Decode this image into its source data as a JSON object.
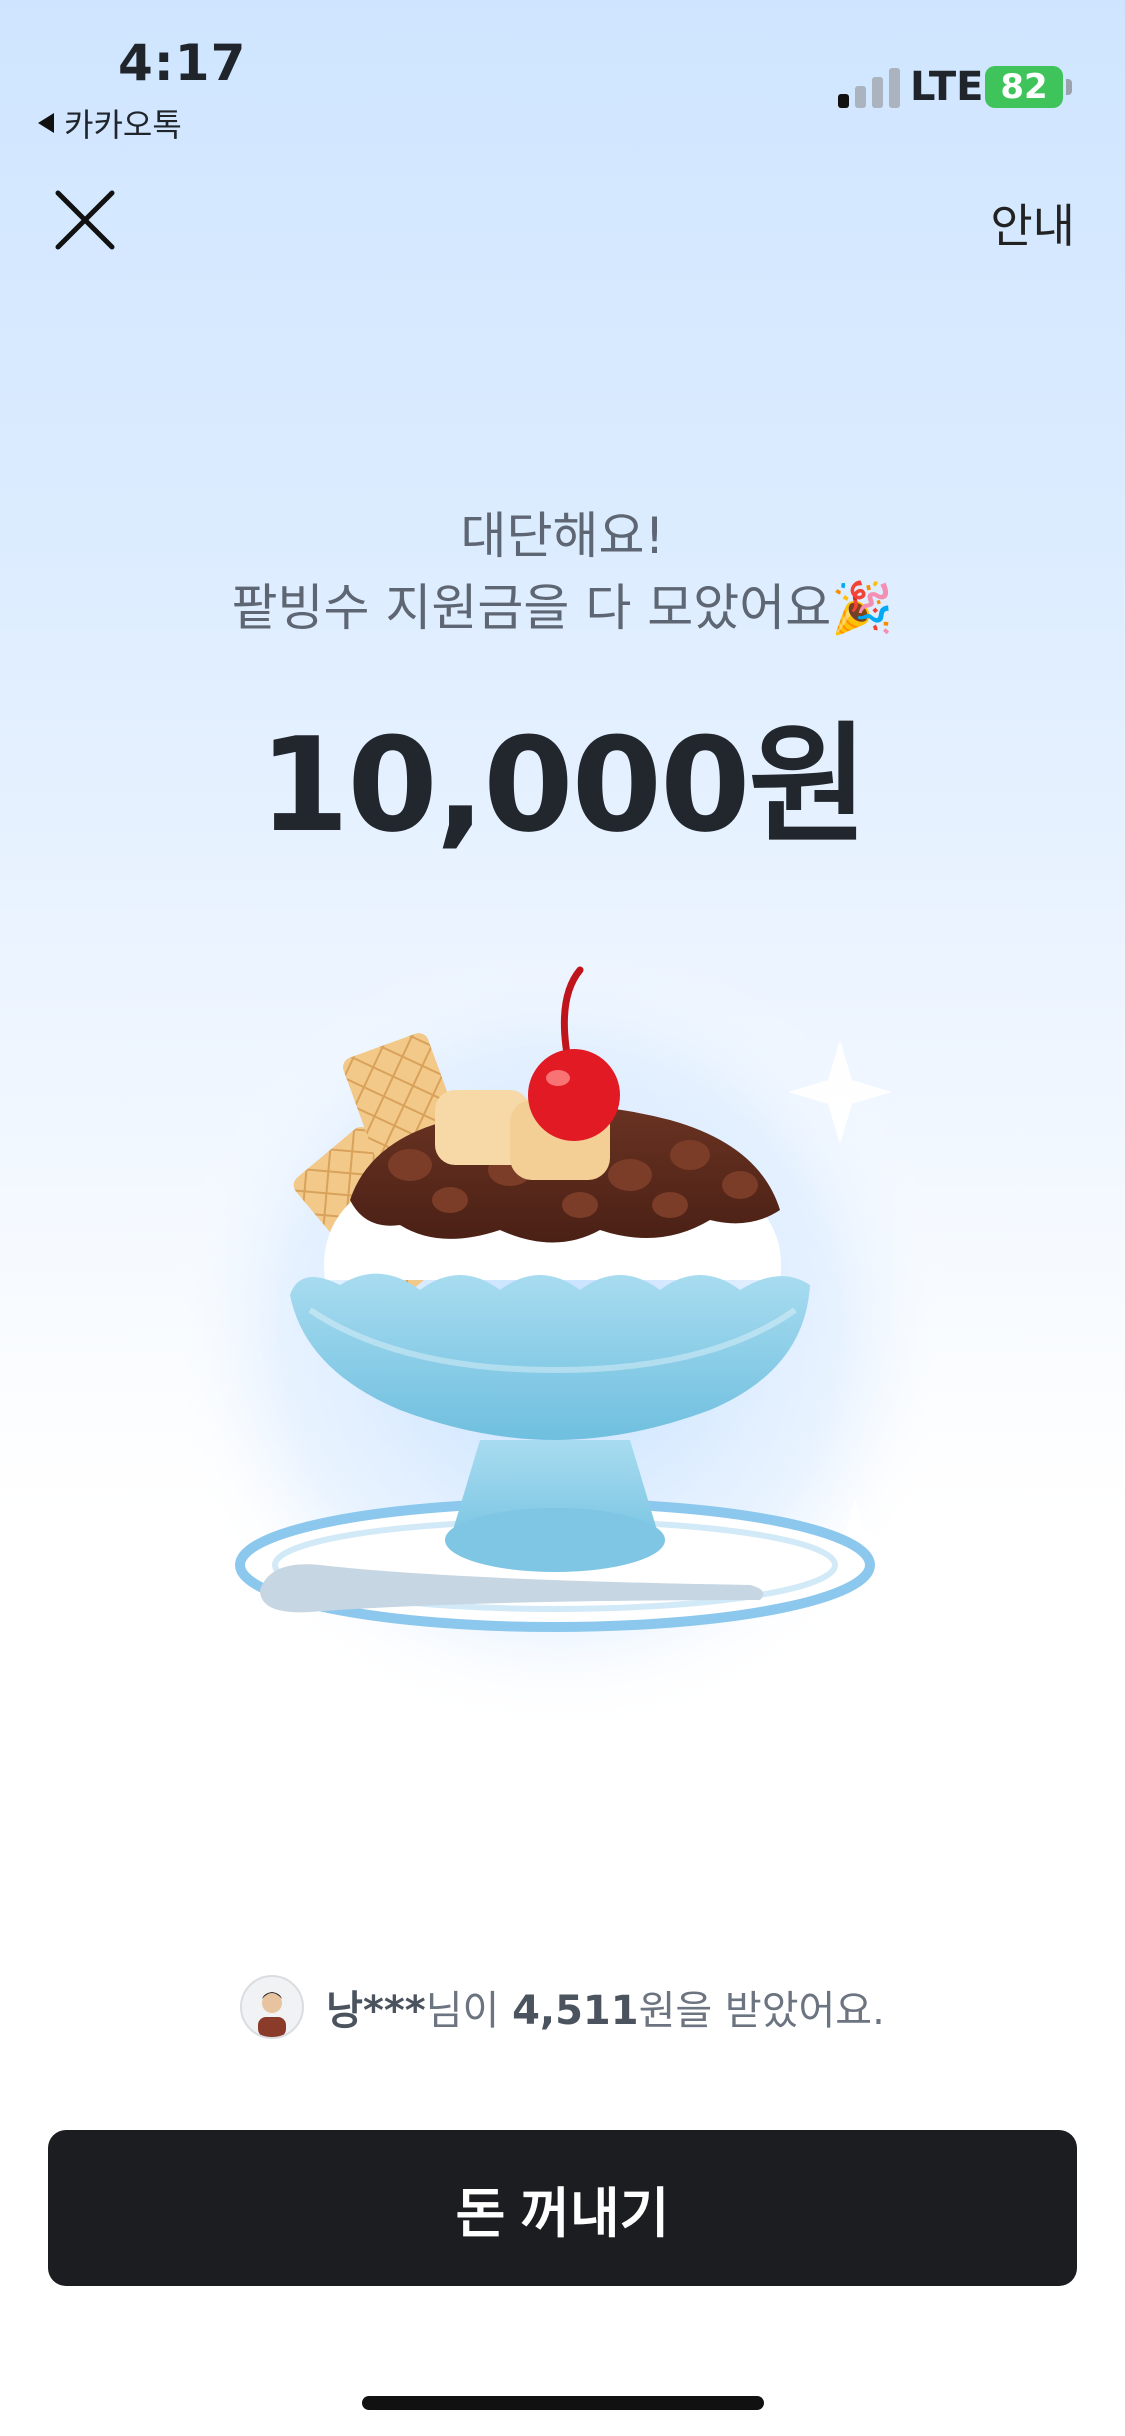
{
  "status_bar": {
    "time": "4:17",
    "back_app": "카카오톡",
    "network": "LTE",
    "battery": "82"
  },
  "header": {
    "info_label": "안내"
  },
  "main": {
    "headline_1": "대단해요!",
    "headline_2": "팥빙수 지원금을 다 모았어요🎉",
    "amount": "10,000원",
    "illustration": "bingsu-icon"
  },
  "ticker": {
    "user": "낭***",
    "text_1": "님이 ",
    "amount": "4,511",
    "text_2": "원을 받았어요."
  },
  "cta": {
    "label": "돈 꺼내기"
  },
  "colors": {
    "cta_bg": "#1c1d20",
    "battery": "#3fc45b",
    "amount_text": "#22272e"
  }
}
